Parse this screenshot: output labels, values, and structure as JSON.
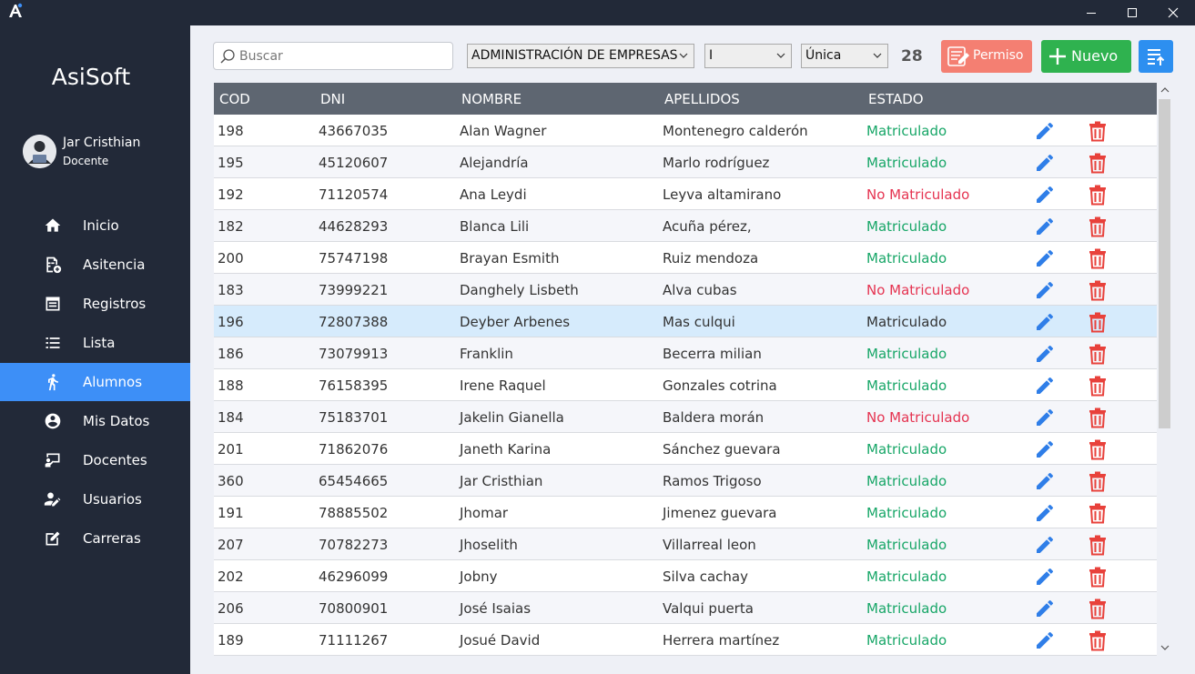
{
  "window": {
    "minimize": "—",
    "maximize": "☐",
    "close": "✕"
  },
  "sidebar": {
    "brand": "AsiSoft",
    "user_name": "Jar Cristhian",
    "user_role": "Docente",
    "items": [
      {
        "label": "Inicio",
        "icon": "home-icon"
      },
      {
        "label": "Asitencia",
        "icon": "attendance-icon"
      },
      {
        "label": "Registros",
        "icon": "records-icon"
      },
      {
        "label": "Lista",
        "icon": "list-icon"
      },
      {
        "label": "Alumnos",
        "icon": "walking-person-icon",
        "active": true
      },
      {
        "label": "Mis Datos",
        "icon": "account-circle-icon"
      },
      {
        "label": "Docentes",
        "icon": "teacher-icon"
      },
      {
        "label": "Usuarios",
        "icon": "user-edit-icon"
      },
      {
        "label": "Carreras",
        "icon": "edit-box-icon"
      }
    ]
  },
  "toolbar": {
    "search_placeholder": "Buscar",
    "carrera": "ADMINISTRACIÓN DE EMPRESAS",
    "ciclo": "I",
    "seccion": "Única",
    "count": "28",
    "permiso_label": "Permiso",
    "nuevo_label": "Nuevo"
  },
  "table": {
    "headers": {
      "cod": "COD",
      "dni": "DNI",
      "nombre": "NOMBRE",
      "apellidos": "APELLIDOS",
      "estado": "ESTADO"
    },
    "selected_index": 6,
    "rows": [
      {
        "cod": "198",
        "dni": "43667035",
        "nombre": "Alan Wagner",
        "apellidos": "Montenegro calderón",
        "estado": "Matriculado"
      },
      {
        "cod": "195",
        "dni": "45120607",
        "nombre": "Alejandría",
        "apellidos": "Marlo rodríguez",
        "estado": "Matriculado"
      },
      {
        "cod": "192",
        "dni": "71120574",
        "nombre": "Ana Leydi",
        "apellidos": "Leyva altamirano",
        "estado": "No Matriculado"
      },
      {
        "cod": "182",
        "dni": "44628293",
        "nombre": "Blanca Lili",
        "apellidos": "Acuña pérez,",
        "estado": "Matriculado"
      },
      {
        "cod": "200",
        "dni": "75747198",
        "nombre": "Brayan Esmith",
        "apellidos": "Ruiz mendoza",
        "estado": "Matriculado"
      },
      {
        "cod": "183",
        "dni": "73999221",
        "nombre": "Danghely Lisbeth",
        "apellidos": "Alva cubas",
        "estado": "No Matriculado"
      },
      {
        "cod": "196",
        "dni": "72807388",
        "nombre": "Deyber Arbenes",
        "apellidos": "Mas culqui",
        "estado": "Matriculado"
      },
      {
        "cod": "186",
        "dni": "73079913",
        "nombre": "Franklin",
        "apellidos": "Becerra milian",
        "estado": "Matriculado"
      },
      {
        "cod": "188",
        "dni": "76158395",
        "nombre": "Irene Raquel",
        "apellidos": "Gonzales cotrina",
        "estado": "Matriculado"
      },
      {
        "cod": "184",
        "dni": "75183701",
        "nombre": "Jakelin Gianella",
        "apellidos": "Baldera morán",
        "estado": "No Matriculado"
      },
      {
        "cod": "201",
        "dni": "71862076",
        "nombre": "Janeth Karina",
        "apellidos": "Sánchez guevara",
        "estado": "Matriculado"
      },
      {
        "cod": "360",
        "dni": "65454665",
        "nombre": "Jar Cristhian",
        "apellidos": "Ramos Trigoso",
        "estado": "Matriculado"
      },
      {
        "cod": "191",
        "dni": "78885502",
        "nombre": "Jhomar",
        "apellidos": "Jimenez guevara",
        "estado": "Matriculado"
      },
      {
        "cod": "207",
        "dni": "70782273",
        "nombre": "Jhoselith",
        "apellidos": "Villarreal leon",
        "estado": "Matriculado"
      },
      {
        "cod": "202",
        "dni": "46296099",
        "nombre": "Jobny",
        "apellidos": "Silva cachay",
        "estado": "Matriculado"
      },
      {
        "cod": "206",
        "dni": "70800901",
        "nombre": "José Isaias",
        "apellidos": "Valqui puerta",
        "estado": "Matriculado"
      },
      {
        "cod": "189",
        "dni": "71111267",
        "nombre": "Josué David",
        "apellidos": "Herrera martínez",
        "estado": "Matriculado"
      }
    ]
  },
  "colors": {
    "sidebar_bg": "#222938",
    "active_item": "#3d8ff7",
    "matriculado": "#17a667",
    "no_matriculado": "#e53451",
    "edit_icon": "#2f7ee8",
    "delete_icon": "#e8413b"
  }
}
